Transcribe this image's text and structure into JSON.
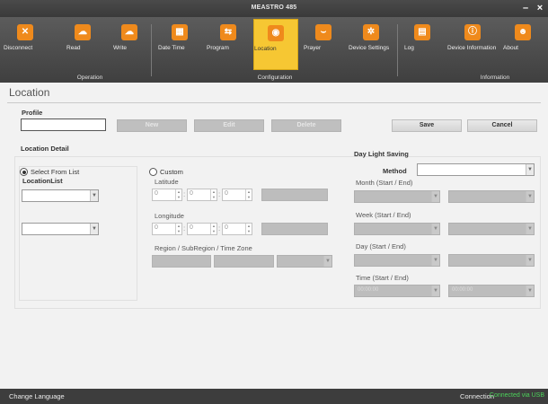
{
  "window": {
    "title": "MEASTRO 485",
    "minimize_label": "–",
    "close_label": "×"
  },
  "ribbon": {
    "groups": [
      {
        "label": "Operation",
        "buttons": [
          {
            "label": "Disconnect",
            "icon": "disconnect-icon"
          },
          {
            "label": "Read",
            "icon": "cloud-download-icon"
          },
          {
            "label": "Write",
            "icon": "cloud-upload-icon"
          }
        ]
      },
      {
        "label": "Configuration",
        "buttons": [
          {
            "label": "Date Time",
            "icon": "calendar-icon"
          },
          {
            "label": "Program",
            "icon": "program-icon"
          },
          {
            "label": "Location",
            "icon": "location-pin-icon",
            "active": true
          },
          {
            "label": "Prayer",
            "icon": "prayer-icon"
          },
          {
            "label": "Device Settings",
            "icon": "gear-icon"
          }
        ]
      },
      {
        "label": "Information",
        "buttons": [
          {
            "label": "Log",
            "icon": "log-icon"
          },
          {
            "label": "Device Information",
            "icon": "info-icon"
          },
          {
            "label": "About",
            "icon": "people-icon"
          }
        ]
      }
    ]
  },
  "page": {
    "title": "Location",
    "profile_label": "Profile",
    "profile_value": "",
    "buttons": {
      "new": "New",
      "edit": "Edit",
      "delete": "Delete",
      "save": "Save",
      "cancel": "Cancel"
    },
    "location_detail": {
      "heading": "Location Detail",
      "select_from_list_label": "Select From List",
      "select_from_list_checked": true,
      "location_list_label": "LocationList",
      "custom_label": "Custom",
      "custom_checked": false,
      "latitude_label": "Latitude",
      "latitude_values": [
        "0",
        "0",
        "0"
      ],
      "longitude_label": "Longitude",
      "longitude_values": [
        "0",
        "0",
        "0"
      ],
      "region_label": "Region / SubRegion / Time Zone"
    },
    "daylight_saving": {
      "heading": "Day Light Saving",
      "method_label": "Method",
      "method_value": "",
      "month_label": "Month (Start / End)",
      "week_label": "Week (Start / End)",
      "day_label": "Day (Start / End)",
      "time_label": "Time (Start / End)",
      "time_start": "00:00:00",
      "time_end": "00:00:00"
    }
  },
  "statusbar": {
    "change_language": "Change Language",
    "connection_label": "Connection",
    "connection_value": "Connected via USB",
    "connection_color": "#4cd35b"
  },
  "colors": {
    "accent_orange": "#ef8a1c",
    "active_tab": "#f6c733"
  }
}
